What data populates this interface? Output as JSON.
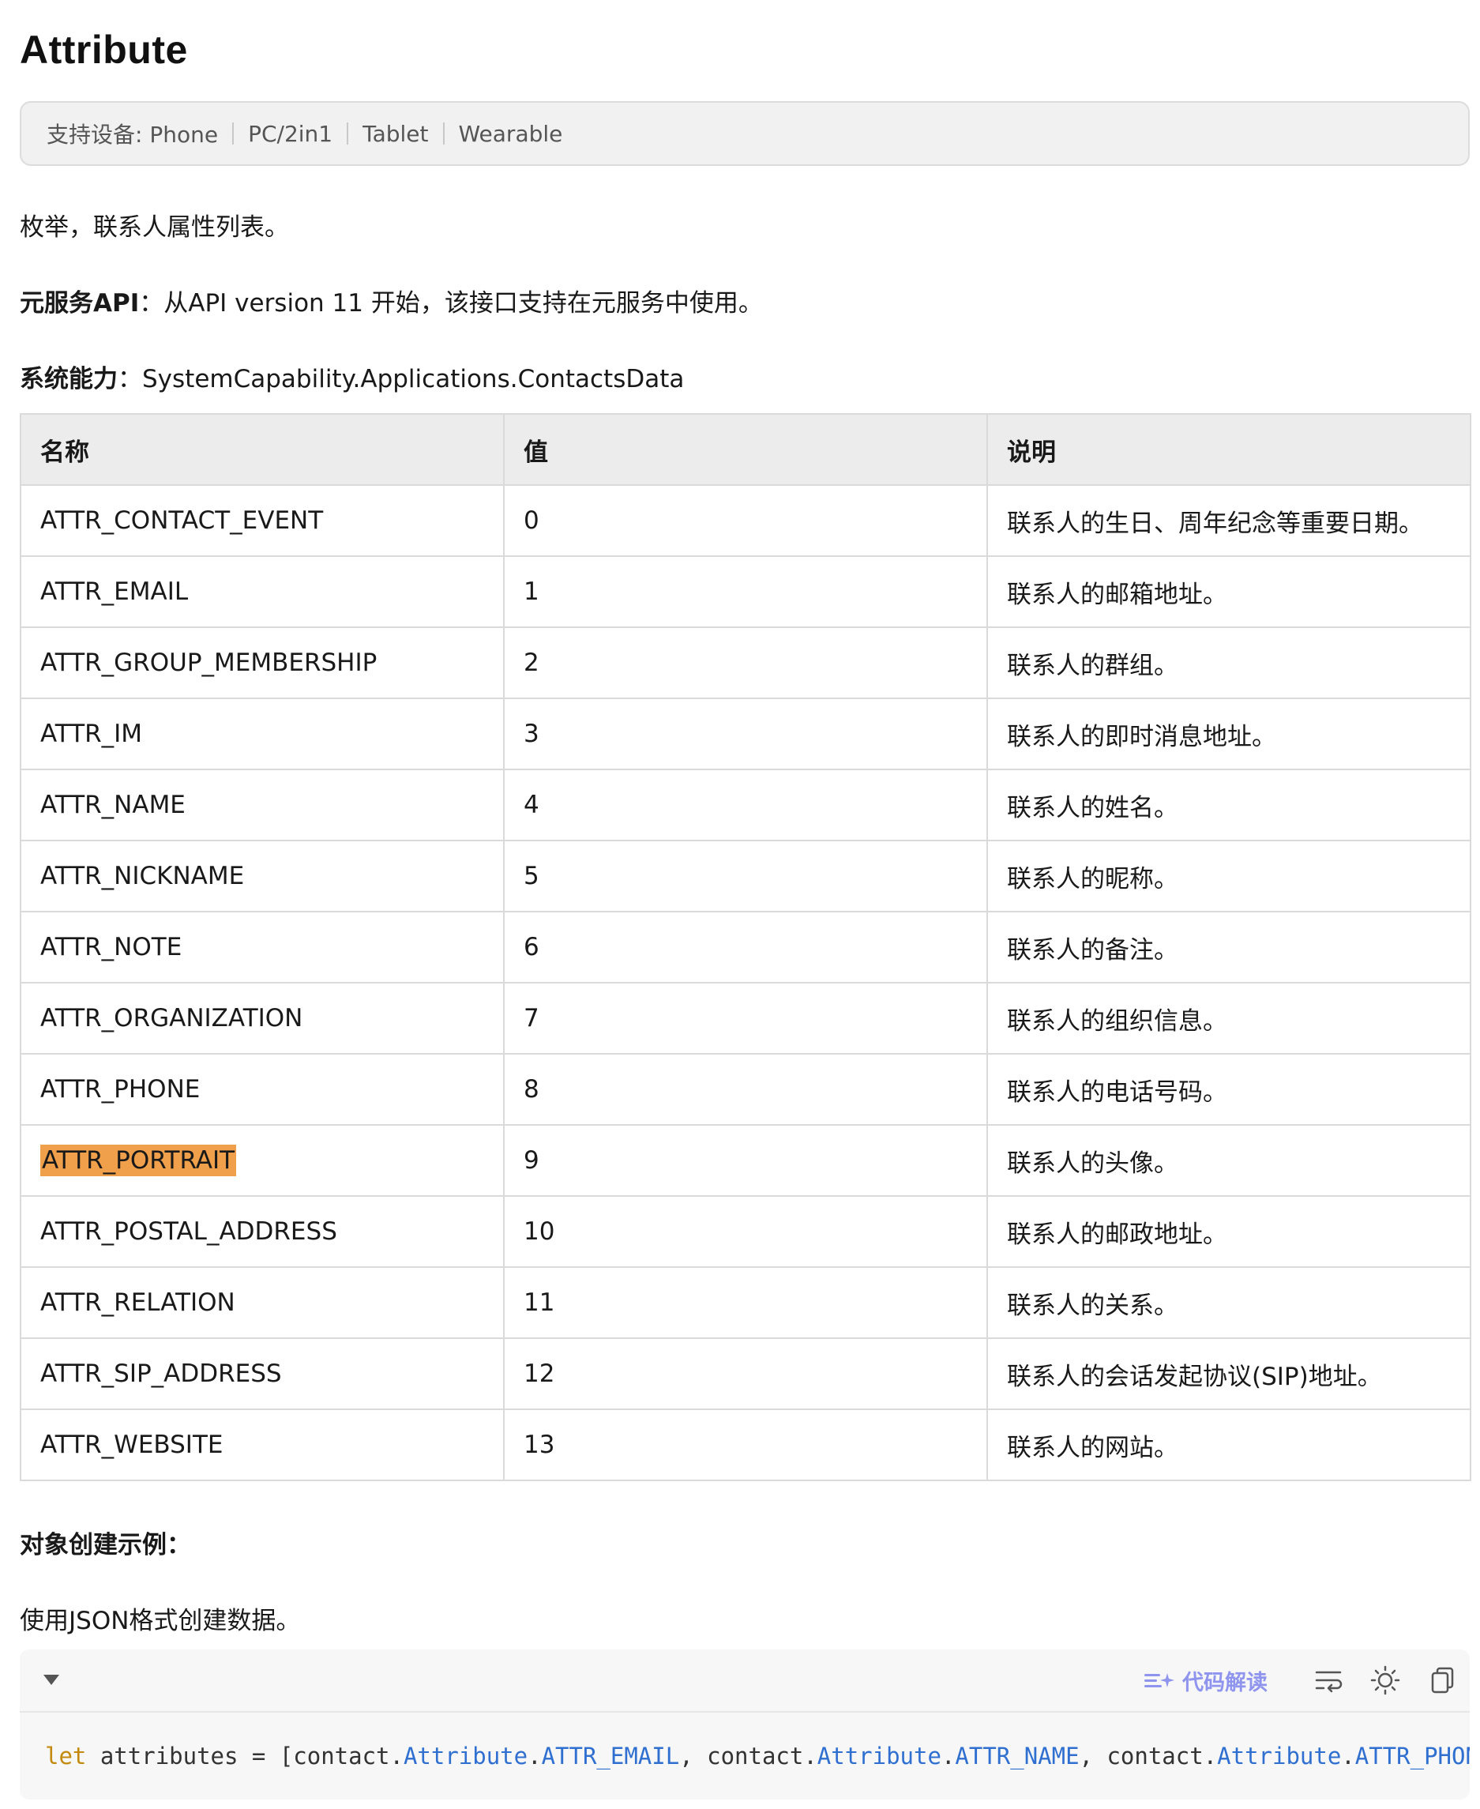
{
  "heading": "Attribute",
  "devices": {
    "label": "支持设备: Phone",
    "items": [
      "PC/2in1",
      "Tablet",
      "Wearable"
    ]
  },
  "intro": "枚举，联系人属性列表。",
  "atomic": {
    "label": "元服务API",
    "text": "：从API version 11 开始，该接口支持在元服务中使用。"
  },
  "syscap": {
    "label": "系统能力",
    "text": "：SystemCapability.Applications.ContactsData"
  },
  "table": {
    "headers": [
      "名称",
      "值",
      "说明"
    ],
    "rows": [
      {
        "name": "ATTR_CONTACT_EVENT",
        "value": "0",
        "desc": "联系人的生日、周年纪念等重要日期。"
      },
      {
        "name": "ATTR_EMAIL",
        "value": "1",
        "desc": "联系人的邮箱地址。"
      },
      {
        "name": "ATTR_GROUP_MEMBERSHIP",
        "value": "2",
        "desc": "联系人的群组。"
      },
      {
        "name": "ATTR_IM",
        "value": "3",
        "desc": "联系人的即时消息地址。"
      },
      {
        "name": "ATTR_NAME",
        "value": "4",
        "desc": "联系人的姓名。"
      },
      {
        "name": "ATTR_NICKNAME",
        "value": "5",
        "desc": "联系人的昵称。"
      },
      {
        "name": "ATTR_NOTE",
        "value": "6",
        "desc": "联系人的备注。"
      },
      {
        "name": "ATTR_ORGANIZATION",
        "value": "7",
        "desc": "联系人的组织信息。"
      },
      {
        "name": "ATTR_PHONE",
        "value": "8",
        "desc": "联系人的电话号码。"
      },
      {
        "name": "ATTR_PORTRAIT",
        "value": "9",
        "desc": "联系人的头像。",
        "highlighted": true
      },
      {
        "name": "ATTR_POSTAL_ADDRESS",
        "value": "10",
        "desc": "联系人的邮政地址。"
      },
      {
        "name": "ATTR_RELATION",
        "value": "11",
        "desc": "联系人的关系。"
      },
      {
        "name": "ATTR_SIP_ADDRESS",
        "value": "12",
        "desc": "联系人的会话发起协议(SIP)地址。"
      },
      {
        "name": "ATTR_WEBSITE",
        "value": "13",
        "desc": "联系人的网站。"
      }
    ]
  },
  "example": {
    "title": "对象创建示例：",
    "text": "使用JSON格式创建数据。"
  },
  "code": {
    "ai_label": "代码解读",
    "kw": "let",
    "ident": " attributes = [contact.",
    "t1": "Attribute",
    "d1": ".",
    "v1": "ATTR_EMAIL",
    "mid1": ", contact.",
    "t2": "Attribute",
    "d2": ".",
    "v2": "ATTR_NAME",
    "mid2": ", contact.",
    "t3": "Attribute",
    "d3": ".",
    "v3": "ATTR_PHONE",
    "end": "];"
  },
  "colors": {
    "highlight": "#f0a04b",
    "keyword": "#c48a0e",
    "type": "#2f6fd0",
    "ai": "#8f95ee"
  }
}
